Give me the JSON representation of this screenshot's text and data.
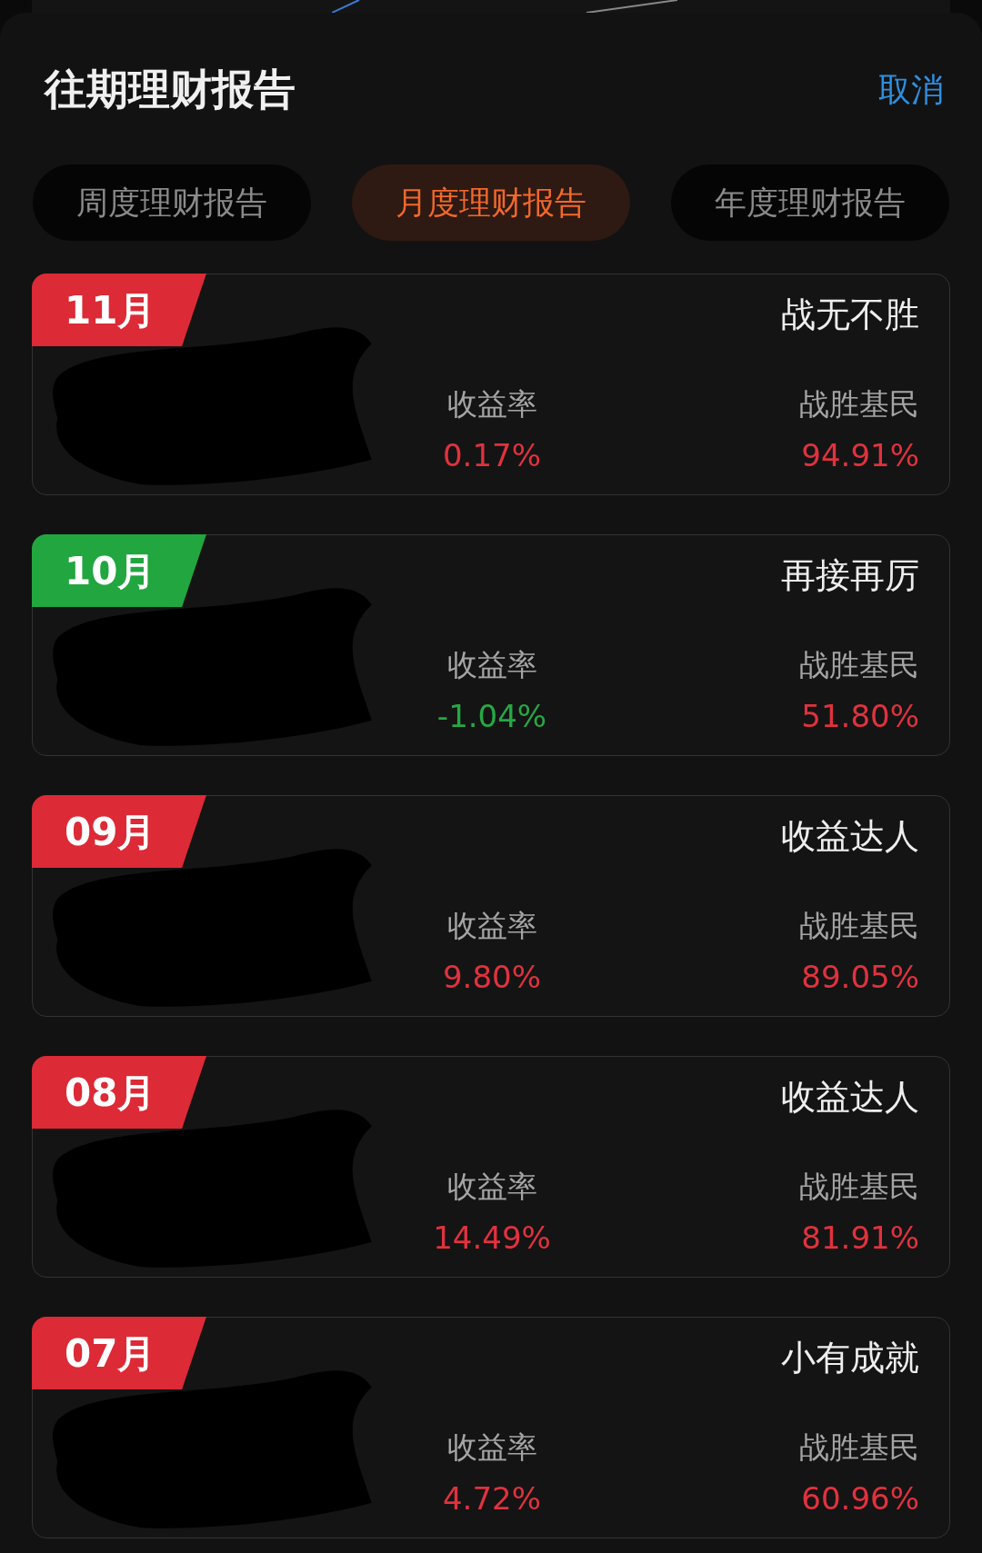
{
  "sheet": {
    "title": "往期理财报告",
    "cancel": "取消"
  },
  "tabs": [
    {
      "label": "周度理财报告",
      "selected": false
    },
    {
      "label": "月度理财报告",
      "selected": true
    },
    {
      "label": "年度理财报告",
      "selected": false
    }
  ],
  "reports": [
    {
      "month": "11月",
      "negative": false,
      "title": "战无不胜",
      "rate_label": "收益率",
      "rate": "0.17%",
      "beat_label": "战胜基民",
      "beat": "94.91%"
    },
    {
      "month": "10月",
      "negative": true,
      "title": "再接再厉",
      "rate_label": "收益率",
      "rate": "-1.04%",
      "beat_label": "战胜基民",
      "beat": "51.80%"
    },
    {
      "month": "09月",
      "negative": false,
      "title": "收益达人",
      "rate_label": "收益率",
      "rate": "9.80%",
      "beat_label": "战胜基民",
      "beat": "89.05%"
    },
    {
      "month": "08月",
      "negative": false,
      "title": "收益达人",
      "rate_label": "收益率",
      "rate": "14.49%",
      "beat_label": "战胜基民",
      "beat": "81.91%"
    },
    {
      "month": "07月",
      "negative": false,
      "title": "小有成就",
      "rate_label": "收益率",
      "rate": "4.72%",
      "beat_label": "战胜基民",
      "beat": "60.96%"
    }
  ]
}
